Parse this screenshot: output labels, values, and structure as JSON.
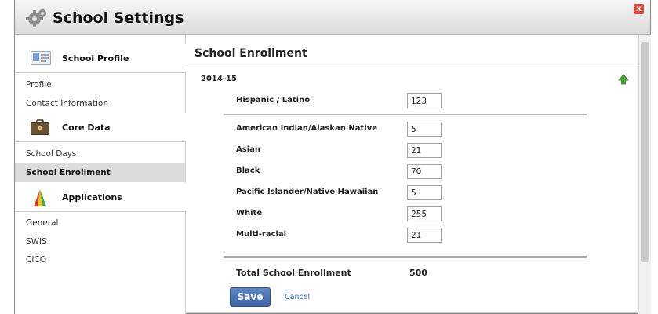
{
  "window": {
    "title": "School Settings",
    "close_glyph": "x"
  },
  "sidebar": {
    "sections": [
      {
        "title": "School Profile",
        "icon": "id-card-icon",
        "items": [
          {
            "label": "Profile",
            "active": false
          },
          {
            "label": "Contact Information",
            "active": false
          }
        ]
      },
      {
        "title": "Core Data",
        "icon": "briefcase-icon",
        "items": [
          {
            "label": "School Days",
            "active": false
          },
          {
            "label": "School Enrollment",
            "active": true
          }
        ]
      },
      {
        "title": "Applications",
        "icon": "pyramid-icon",
        "items": [
          {
            "label": "General",
            "active": false
          },
          {
            "label": "SWIS",
            "active": false
          },
          {
            "label": "CICO",
            "active": false
          }
        ]
      }
    ]
  },
  "main": {
    "title": "School Enrollment",
    "year": "2014-15",
    "hispanic": {
      "label": "Hispanic / Latino",
      "value": "123"
    },
    "races": [
      {
        "label": "American Indian/Alaskan Native",
        "value": "5"
      },
      {
        "label": "Asian",
        "value": "21"
      },
      {
        "label": "Black",
        "value": "70"
      },
      {
        "label": "Pacific Islander/Native Hawaiian",
        "value": "5"
      },
      {
        "label": "White",
        "value": "255"
      },
      {
        "label": "Multi-racial",
        "value": "21"
      }
    ],
    "total": {
      "label": "Total School Enrollment",
      "value": "500"
    },
    "save_label": "Save",
    "cancel_label": "Cancel"
  },
  "colors": {
    "accent": "#3e64a4",
    "link": "#3a64b4",
    "active_nav": "#dcdcdc",
    "arrow": "#4aa83c",
    "close": "#d84c3c"
  }
}
